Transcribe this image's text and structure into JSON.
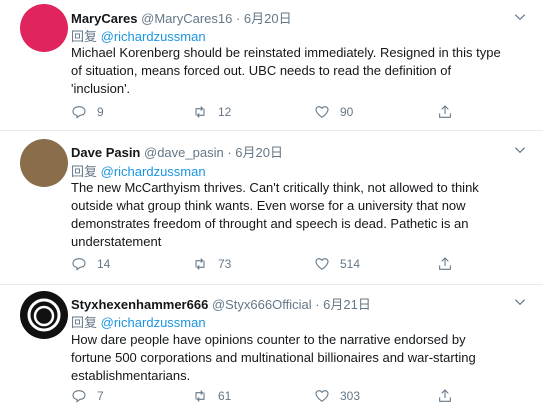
{
  "tweets": [
    {
      "name": "MaryCares",
      "handle": "@MaryCares16",
      "date": "· 6月20日",
      "reply_prefix": "回复",
      "reply_to": "@richardzussman",
      "text": "Michael Korenberg should be reinstated immediately.  Resigned in this type of situation, means forced out.  UBC needs to read the definition of 'inclusion'.",
      "replies": "9",
      "retweets": "12",
      "likes": "90",
      "avatar_color": "#e0245e"
    },
    {
      "name": "Dave Pasin",
      "handle": "@dave_pasin",
      "date": "· 6月20日",
      "reply_prefix": "回复",
      "reply_to": "@richardzussman",
      "text": "The new McCarthyism thrives. Can't critically think, not allowed to think outside what group think wants. Even worse for a university that now demonstrates freedom of throught and speech is dead.  Pathetic is an understatement",
      "replies": "14",
      "retweets": "73",
      "likes": "514",
      "avatar_color": "#8a6d4a"
    },
    {
      "name": "Styxhexenhammer666",
      "handle": "@Styx666Official",
      "date": "· 6月21日",
      "reply_prefix": "回复",
      "reply_to": "@richardzussman",
      "text": "How dare people have opinions counter to the narrative endorsed by fortune 500 corporations and multinational billionaires and war-starting establishmentarians.",
      "replies": "7",
      "retweets": "61",
      "likes": "303",
      "avatar_color": "#111111"
    }
  ],
  "colors": {
    "link": "#1b95e0",
    "muted": "#657786",
    "text": "#14171a",
    "divider": "#e6ecf0"
  }
}
